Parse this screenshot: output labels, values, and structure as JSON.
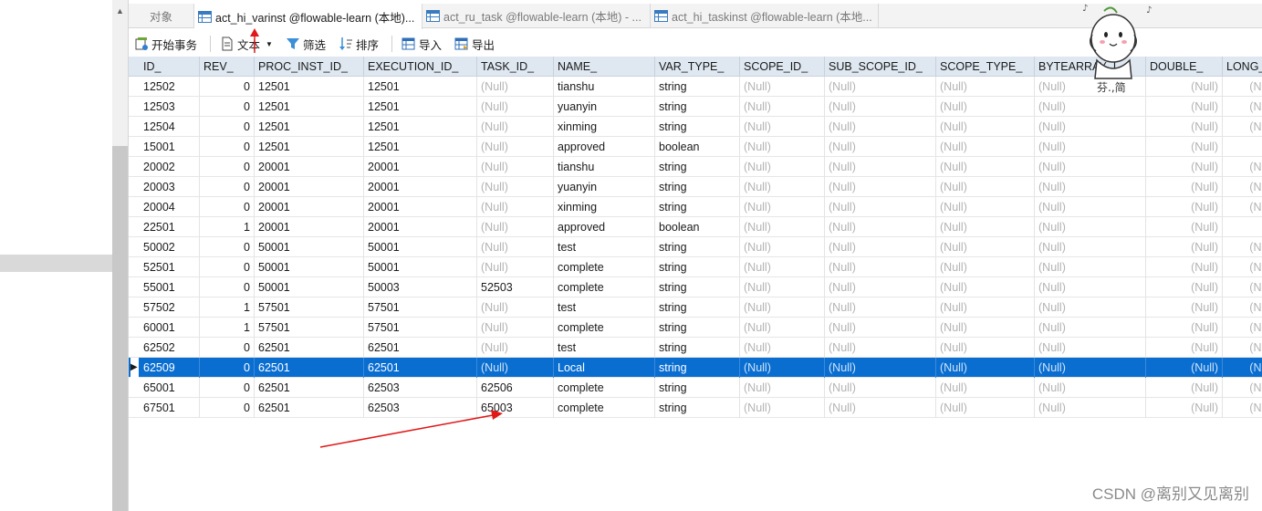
{
  "tabs": [
    {
      "label": "对象"
    },
    {
      "label": "act_hi_varinst @flowable-learn (本地)..."
    },
    {
      "label": "act_ru_task @flowable-learn (本地) - ..."
    },
    {
      "label": "act_hi_taskinst @flowable-learn (本地..."
    }
  ],
  "toolbar": {
    "begin_transaction": "开始事务",
    "text": "文本",
    "filter": "筛选",
    "sort": "排序",
    "import": "导入",
    "export": "导出"
  },
  "columns": [
    "ID_",
    "REV_",
    "PROC_INST_ID_",
    "EXECUTION_ID_",
    "TASK_ID_",
    "NAME_",
    "VAR_TYPE_",
    "SCOPE_ID_",
    "SUB_SCOPE_ID_",
    "SCOPE_TYPE_",
    "BYTEARRAY_I",
    "DOUBLE_",
    "LONG_"
  ],
  "rows": [
    [
      "12502",
      "0",
      "12501",
      "12501",
      "(Null)",
      "tianshu",
      "string",
      "(Null)",
      "(Null)",
      "(Null)",
      "(Null)",
      "(Null)",
      "(Null"
    ],
    [
      "12503",
      "0",
      "12501",
      "12501",
      "(Null)",
      "yuanyin",
      "string",
      "(Null)",
      "(Null)",
      "(Null)",
      "(Null)",
      "(Null)",
      "(Null"
    ],
    [
      "12504",
      "0",
      "12501",
      "12501",
      "(Null)",
      "xinming",
      "string",
      "(Null)",
      "(Null)",
      "(Null)",
      "(Null)",
      "(Null)",
      "(Null"
    ],
    [
      "15001",
      "0",
      "12501",
      "12501",
      "(Null)",
      "approved",
      "boolean",
      "(Null)",
      "(Null)",
      "(Null)",
      "(Null)",
      "(Null)",
      ""
    ],
    [
      "20002",
      "0",
      "20001",
      "20001",
      "(Null)",
      "tianshu",
      "string",
      "(Null)",
      "(Null)",
      "(Null)",
      "(Null)",
      "(Null)",
      "(Null"
    ],
    [
      "20003",
      "0",
      "20001",
      "20001",
      "(Null)",
      "yuanyin",
      "string",
      "(Null)",
      "(Null)",
      "(Null)",
      "(Null)",
      "(Null)",
      "(Null"
    ],
    [
      "20004",
      "0",
      "20001",
      "20001",
      "(Null)",
      "xinming",
      "string",
      "(Null)",
      "(Null)",
      "(Null)",
      "(Null)",
      "(Null)",
      "(Null"
    ],
    [
      "22501",
      "1",
      "20001",
      "20001",
      "(Null)",
      "approved",
      "boolean",
      "(Null)",
      "(Null)",
      "(Null)",
      "(Null)",
      "(Null)",
      ""
    ],
    [
      "50002",
      "0",
      "50001",
      "50001",
      "(Null)",
      "test",
      "string",
      "(Null)",
      "(Null)",
      "(Null)",
      "(Null)",
      "(Null)",
      "(Null"
    ],
    [
      "52501",
      "0",
      "50001",
      "50001",
      "(Null)",
      "complete",
      "string",
      "(Null)",
      "(Null)",
      "(Null)",
      "(Null)",
      "(Null)",
      "(Null"
    ],
    [
      "55001",
      "0",
      "50001",
      "50003",
      "52503",
      "complete",
      "string",
      "(Null)",
      "(Null)",
      "(Null)",
      "(Null)",
      "(Null)",
      "(Null"
    ],
    [
      "57502",
      "1",
      "57501",
      "57501",
      "(Null)",
      "test",
      "string",
      "(Null)",
      "(Null)",
      "(Null)",
      "(Null)",
      "(Null)",
      "(Null"
    ],
    [
      "60001",
      "1",
      "57501",
      "57501",
      "(Null)",
      "complete",
      "string",
      "(Null)",
      "(Null)",
      "(Null)",
      "(Null)",
      "(Null)",
      "(Null"
    ],
    [
      "62502",
      "0",
      "62501",
      "62501",
      "(Null)",
      "test",
      "string",
      "(Null)",
      "(Null)",
      "(Null)",
      "(Null)",
      "(Null)",
      "(Null"
    ],
    [
      "62509",
      "0",
      "62501",
      "62501",
      "(Null)",
      "Local",
      "string",
      "(Null)",
      "(Null)",
      "(Null)",
      "(Null)",
      "(Null)",
      "(Null"
    ],
    [
      "65001",
      "0",
      "62501",
      "62503",
      "62506",
      "complete",
      "string",
      "(Null)",
      "(Null)",
      "(Null)",
      "(Null)",
      "(Null)",
      "(Null"
    ],
    [
      "67501",
      "0",
      "62501",
      "62503",
      "65003",
      "complete",
      "string",
      "(Null)",
      "(Null)",
      "(Null)",
      "(Null)",
      "(Null)",
      "(Null"
    ]
  ],
  "selected_row_index": 14,
  "row_marker": "▶",
  "watermark": "CSDN @离别又见离别",
  "sticker_text": "芬.,简",
  "colors": {
    "selection": "#0a6ed1",
    "header_bg": "#dfe8f1",
    "null_text": "#b3b3b3",
    "annotation_arrow": "#e01818"
  }
}
